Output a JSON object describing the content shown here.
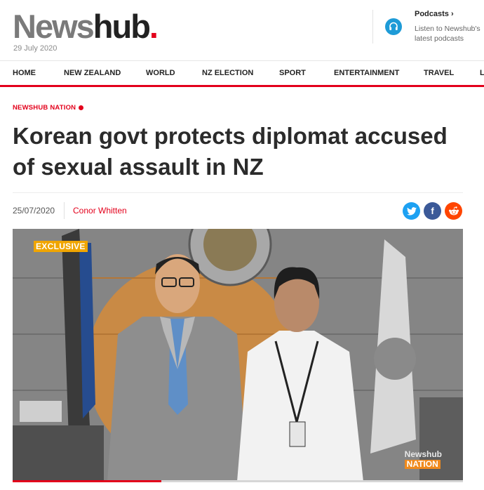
{
  "site": {
    "logo_news": "News",
    "logo_hub": "hub",
    "logo_dot": ".",
    "date": "29 July 2020"
  },
  "podcasts": {
    "title": "Podcasts ›",
    "subtitle": "Listen to Newshub's latest podcasts",
    "icon": "headphones-icon",
    "icon_color": "#1e9bd7"
  },
  "nav": {
    "items": [
      "HOME",
      "NEW ZEALAND",
      "WORLD",
      "NZ ELECTION",
      "SPORT",
      "ENTERTAINMENT",
      "TRAVEL",
      "L"
    ]
  },
  "article": {
    "section": "NEWSHUB NATION",
    "headline": "Korean govt protects diplomat accused of sexual assault in NZ",
    "date": "25/07/2020",
    "author": "Conor Whitten",
    "share": [
      {
        "name": "twitter",
        "icon": "twitter-icon",
        "color": "#1da1f2"
      },
      {
        "name": "facebook",
        "icon": "facebook-icon",
        "color": "#3b5998",
        "glyph": "f"
      },
      {
        "name": "reddit",
        "icon": "reddit-icon",
        "color": "#ff4500"
      }
    ]
  },
  "photo": {
    "badge": "EXCLUSIVE",
    "watermark_top": "Newshub",
    "watermark_bottom": "NATION",
    "progress": 0.33
  },
  "colors": {
    "brand_red": "#e3001b",
    "exclusive_orange": "#f0a500"
  }
}
